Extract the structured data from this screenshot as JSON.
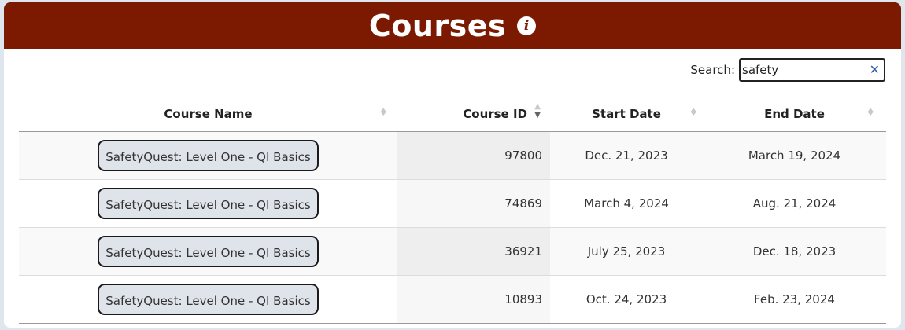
{
  "header": {
    "title": "Courses",
    "info_icon": "info-icon"
  },
  "search": {
    "label": "Search:",
    "value": "safety",
    "clear_icon": "clear-x-icon"
  },
  "table": {
    "columns": [
      {
        "label": "Course Name",
        "sort": "none"
      },
      {
        "label": "Course ID",
        "sort": "descending"
      },
      {
        "label": "Start Date",
        "sort": "none"
      },
      {
        "label": "End Date",
        "sort": "none"
      }
    ],
    "rows": [
      {
        "name": "SafetyQuest: Level One - QI Basics",
        "id": "97800",
        "start": "Dec. 21, 2023",
        "end": "March 19, 2024"
      },
      {
        "name": "SafetyQuest: Level One - QI Basics",
        "id": "74869",
        "start": "March 4, 2024",
        "end": "Aug. 21, 2024"
      },
      {
        "name": "SafetyQuest: Level One - QI Basics",
        "id": "36921",
        "start": "July 25, 2023",
        "end": "Dec. 18, 2023"
      },
      {
        "name": "SafetyQuest: Level One - QI Basics",
        "id": "10893",
        "start": "Oct. 24, 2023",
        "end": "Feb. 23, 2024"
      }
    ]
  },
  "colors": {
    "header_bg": "#7b1a01",
    "page_bg": "#dfe6ee",
    "button_bg": "#dfe4eb",
    "clear_icon": "#2f5aa8"
  }
}
